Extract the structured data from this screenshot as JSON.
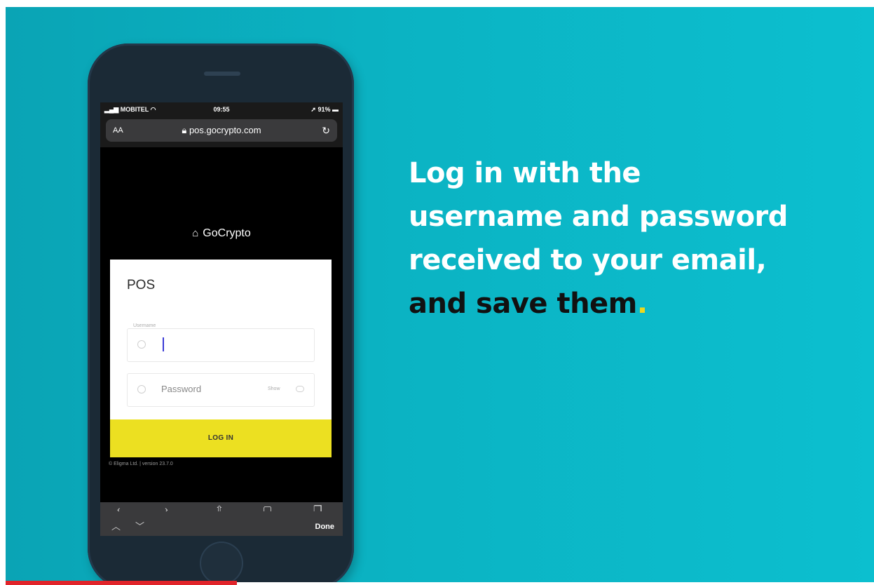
{
  "phone": {
    "status": {
      "carrier": "MOBITEL",
      "time": "09:55",
      "battery": "91%"
    },
    "browser": {
      "text_size": "AA",
      "url": "pos.gocrypto.com",
      "reload_icon": "reload-icon",
      "done_label": "Done"
    },
    "app": {
      "brand": "GoCrypto",
      "title": "POS",
      "username_label": "Username",
      "username_value": "",
      "password_placeholder": "Password",
      "show_label": "Show",
      "login_label": "LOG IN",
      "footer": "© Eligma Ltd. | version 23.7.0"
    }
  },
  "headline": {
    "line1": "Log in with the",
    "line2": "username and password",
    "line3": "received to your email,",
    "line4": "and save them",
    "dot": "."
  },
  "colors": {
    "background": "#0bb3c3",
    "accent_yellow": "#ece021",
    "phone_body": "#1b2a36"
  }
}
